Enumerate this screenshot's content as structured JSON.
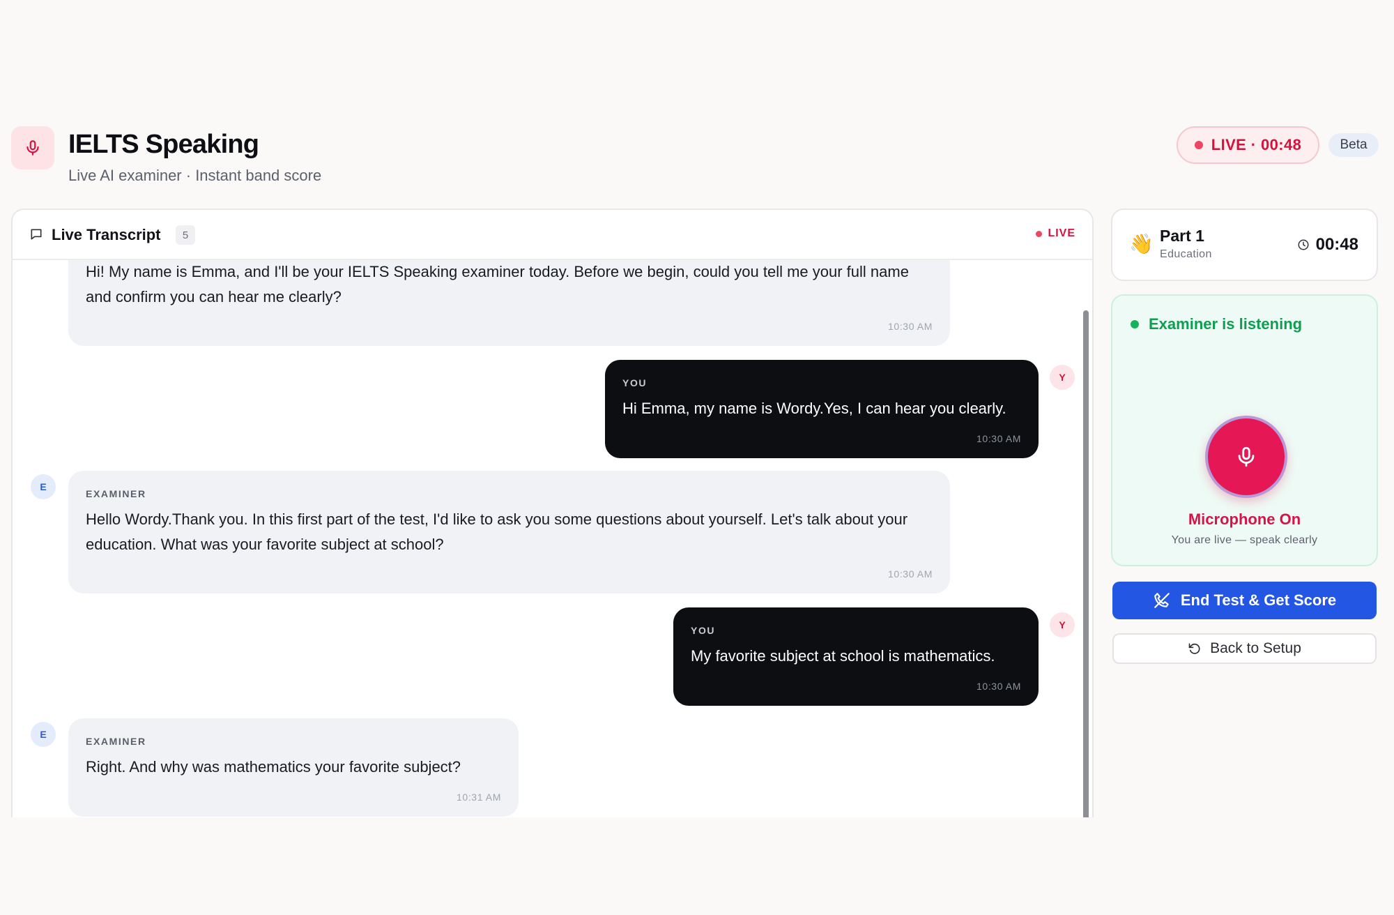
{
  "header": {
    "title": "IELTS Speaking",
    "subtitle": "Live AI examiner · Instant band score",
    "live_timer": "LIVE · 00:48",
    "beta": "Beta"
  },
  "transcript": {
    "title": "Live Transcript",
    "count": "5",
    "live": "LIVE",
    "messages": [
      {
        "role": "examiner",
        "label": "",
        "text": "Hi! My name is Emma, and I'll be your IELTS Speaking examiner today. Before we begin, could you tell me your full name and confirm you can hear me clearly?",
        "time": "10:30 AM"
      },
      {
        "role": "you",
        "avatar": "Y",
        "label": "YOU",
        "text": "Hi Emma, my name is Wordy.Yes, I can hear you clearly.",
        "time": "10:30 AM"
      },
      {
        "role": "examiner",
        "avatar": "E",
        "label": "EXAMINER",
        "text": "Hello Wordy.Thank you. In this first part of the test, I'd like to ask you some questions about yourself. Let's talk about your education. What was your favorite subject at school?",
        "time": "10:30 AM"
      },
      {
        "role": "you",
        "avatar": "Y",
        "label": "YOU",
        "text": "My favorite subject at school is mathematics.",
        "time": "10:30 AM"
      },
      {
        "role": "examiner",
        "avatar": "E",
        "label": "EXAMINER",
        "text": "Right. And why was mathematics your favorite subject?",
        "time": "10:31 AM"
      }
    ]
  },
  "part_card": {
    "emoji": "👋",
    "title": "Part 1",
    "topic": "Education",
    "timer": "00:48"
  },
  "listening": {
    "status": "Examiner is listening",
    "mic_label": "Microphone On",
    "mic_sub": "You are live — speak clearly"
  },
  "actions": {
    "end_test": "End Test & Get Score",
    "back": "Back to Setup"
  },
  "colors": {
    "accent_red": "#d4123d",
    "mic_red": "#e51755",
    "listening_green": "#0f9d4f",
    "primary_blue": "#2356e3",
    "user_bubble": "#0c0e12"
  },
  "icons": {
    "app": "microphone-icon",
    "transcript": "chat-bubble-icon",
    "part": "waving-hand-icon",
    "timer": "clock-icon",
    "mic": "microphone-icon",
    "end": "phone-off-icon",
    "back": "rotate-ccw-icon"
  }
}
